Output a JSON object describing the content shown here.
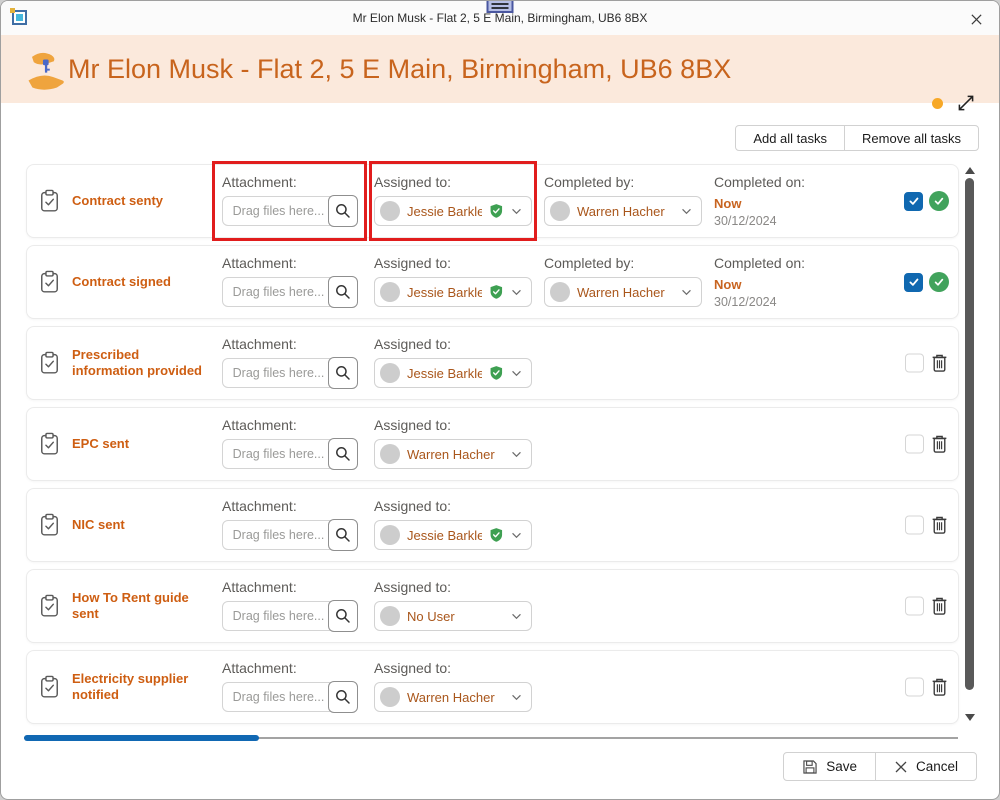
{
  "window": {
    "title": "Mr Elon Musk - Flat 2, 5 E Main, Birmingham, UB6 8BX"
  },
  "header": {
    "title": "Mr Elon Musk - Flat 2, 5 E Main, Birmingham, UB6 8BX"
  },
  "toolbar": {
    "add_all_label": "Add all tasks",
    "remove_all_label": "Remove all tasks"
  },
  "labels": {
    "attachment": "Attachment:",
    "assigned_to": "Assigned to:",
    "completed_by": "Completed by:",
    "completed_on": "Completed on:",
    "drag_placeholder": "Drag files here..."
  },
  "tasks": [
    {
      "title": "Contract senty",
      "assigned_to": "Jessie Barkle",
      "assigned_verified": true,
      "completed": true,
      "completed_by": "Warren Hacher",
      "completed_on_primary": "Now",
      "completed_on_date": "30/12/2024",
      "highlight_attachment_and_assigned": true
    },
    {
      "title": "Contract signed",
      "assigned_to": "Jessie Barkle",
      "assigned_verified": true,
      "completed": true,
      "completed_by": "Warren Hacher",
      "completed_on_primary": "Now",
      "completed_on_date": "30/12/2024",
      "highlight_attachment_and_assigned": false
    },
    {
      "title": "Prescribed information provided",
      "assigned_to": "Jessie Barkle",
      "assigned_verified": true,
      "completed": false,
      "highlight_attachment_and_assigned": false
    },
    {
      "title": "EPC sent",
      "assigned_to": "Warren Hacher",
      "assigned_verified": false,
      "completed": false,
      "highlight_attachment_and_assigned": false
    },
    {
      "title": "NIC sent",
      "assigned_to": "Jessie Barkle",
      "assigned_verified": true,
      "completed": false,
      "highlight_attachment_and_assigned": false
    },
    {
      "title": "How To Rent guide sent",
      "assigned_to": "No User",
      "assigned_verified": false,
      "completed": false,
      "highlight_attachment_and_assigned": false
    },
    {
      "title": "Electricity supplier notified",
      "assigned_to": "Warren Hacher",
      "assigned_verified": false,
      "completed": false,
      "highlight_attachment_and_assigned": false
    }
  ],
  "footer": {
    "save_label": "Save",
    "cancel_label": "Cancel"
  },
  "icons": {
    "app": "app-window-icon",
    "header": "hand-giving-key-icon",
    "search": "search-icon",
    "verified": "verified-shield-icon",
    "completed": "check-circle-icon",
    "delete": "trash-icon",
    "task": "clipboard-check-icon",
    "save": "floppy-disk-icon",
    "cancel": "x-icon",
    "expand": "diagonal-resize-icon",
    "close": "close-icon"
  },
  "colors": {
    "header_bg": "#FBE9DC",
    "accent_orange": "#C8641D",
    "task_title_orange": "#CE5E12",
    "name_text": "#A9561B",
    "label_text": "#5D5B58",
    "checkbox_blue": "#1068B0",
    "status_green": "#41A35C",
    "annotation_red": "#E11D1D",
    "progress_blue": "#1168B3",
    "status_dot": "#F7A827"
  }
}
